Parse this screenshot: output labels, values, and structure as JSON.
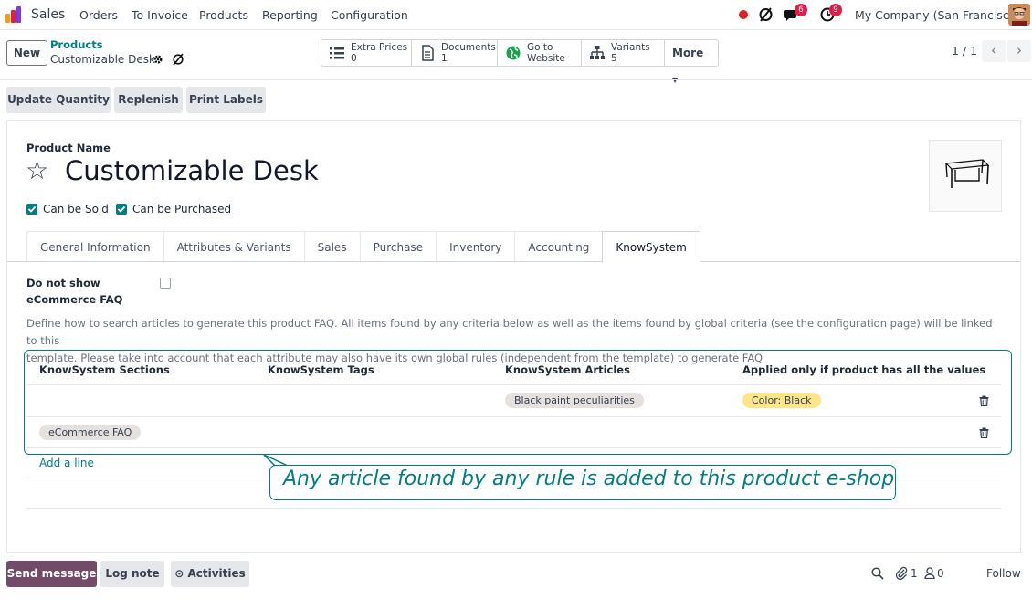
{
  "nav": {
    "app_title": "Sales",
    "menu": [
      "Orders",
      "To Invoice",
      "Products",
      "Reporting",
      "Configuration"
    ],
    "messages_badge": "6",
    "activities_badge": "9",
    "company": "My Company (San Francisco)"
  },
  "control": {
    "new_label": "New",
    "breadcrumb_parent": "Products",
    "breadcrumb_current": "Customizable Desk",
    "smart_buttons": [
      {
        "label": "Extra Prices",
        "value": "0",
        "icon": "list-icon"
      },
      {
        "label": "Documents",
        "value": "1",
        "icon": "document-icon"
      },
      {
        "label": "Go to",
        "value": "Website",
        "icon": "globe-icon"
      },
      {
        "label": "Variants",
        "value": "5",
        "icon": "sitemap-icon"
      }
    ],
    "more_label": "More",
    "pager": "1 / 1"
  },
  "actions": [
    "Update Quantity",
    "Replenish",
    "Print Labels"
  ],
  "product": {
    "name_label": "Product Name",
    "name": "Customizable Desk",
    "can_be_sold": "Can be Sold",
    "can_be_purchased": "Can be Purchased"
  },
  "tabs": [
    "General Information",
    "Attributes & Variants",
    "Sales",
    "Purchase",
    "Inventory",
    "Accounting",
    "KnowSystem"
  ],
  "active_tab": "KnowSystem",
  "knowsystem": {
    "do_not_show_label_1": "Do not show",
    "do_not_show_label_2": "eCommerce FAQ",
    "description_line_1": "Define how to search articles to generate this product FAQ. All items found by any criteria below as well as the items found by global criteria (see the configuration page) will be linked to this",
    "description_line_2": "template. Please take into account that each attribute may also have its own global rules (independent from the template) to generate FAQ",
    "columns": [
      "KnowSystem Sections",
      "KnowSystem Tags",
      "KnowSystem Articles",
      "Applied only if product has all the values"
    ],
    "rows": [
      {
        "section": "",
        "tag": "",
        "article": "Black paint peculiarities",
        "values": "Color: Black"
      },
      {
        "section": "eCommerce FAQ",
        "tag": "",
        "article": "",
        "values": ""
      }
    ],
    "add_line": "Add a line"
  },
  "callout": "Any article found by any rule is added to this product e-shop",
  "chatter": {
    "send_message": "Send message",
    "log_note": "Log note",
    "activities": "Activities",
    "attachments": "1",
    "followers": "0",
    "follow": "Follow"
  },
  "colors": {
    "primary": "#714b67",
    "teal": "#017e84",
    "tag_grey": "#e5e1de",
    "tag_yellow": "#fde68a",
    "badge_red": "#e11d48"
  }
}
